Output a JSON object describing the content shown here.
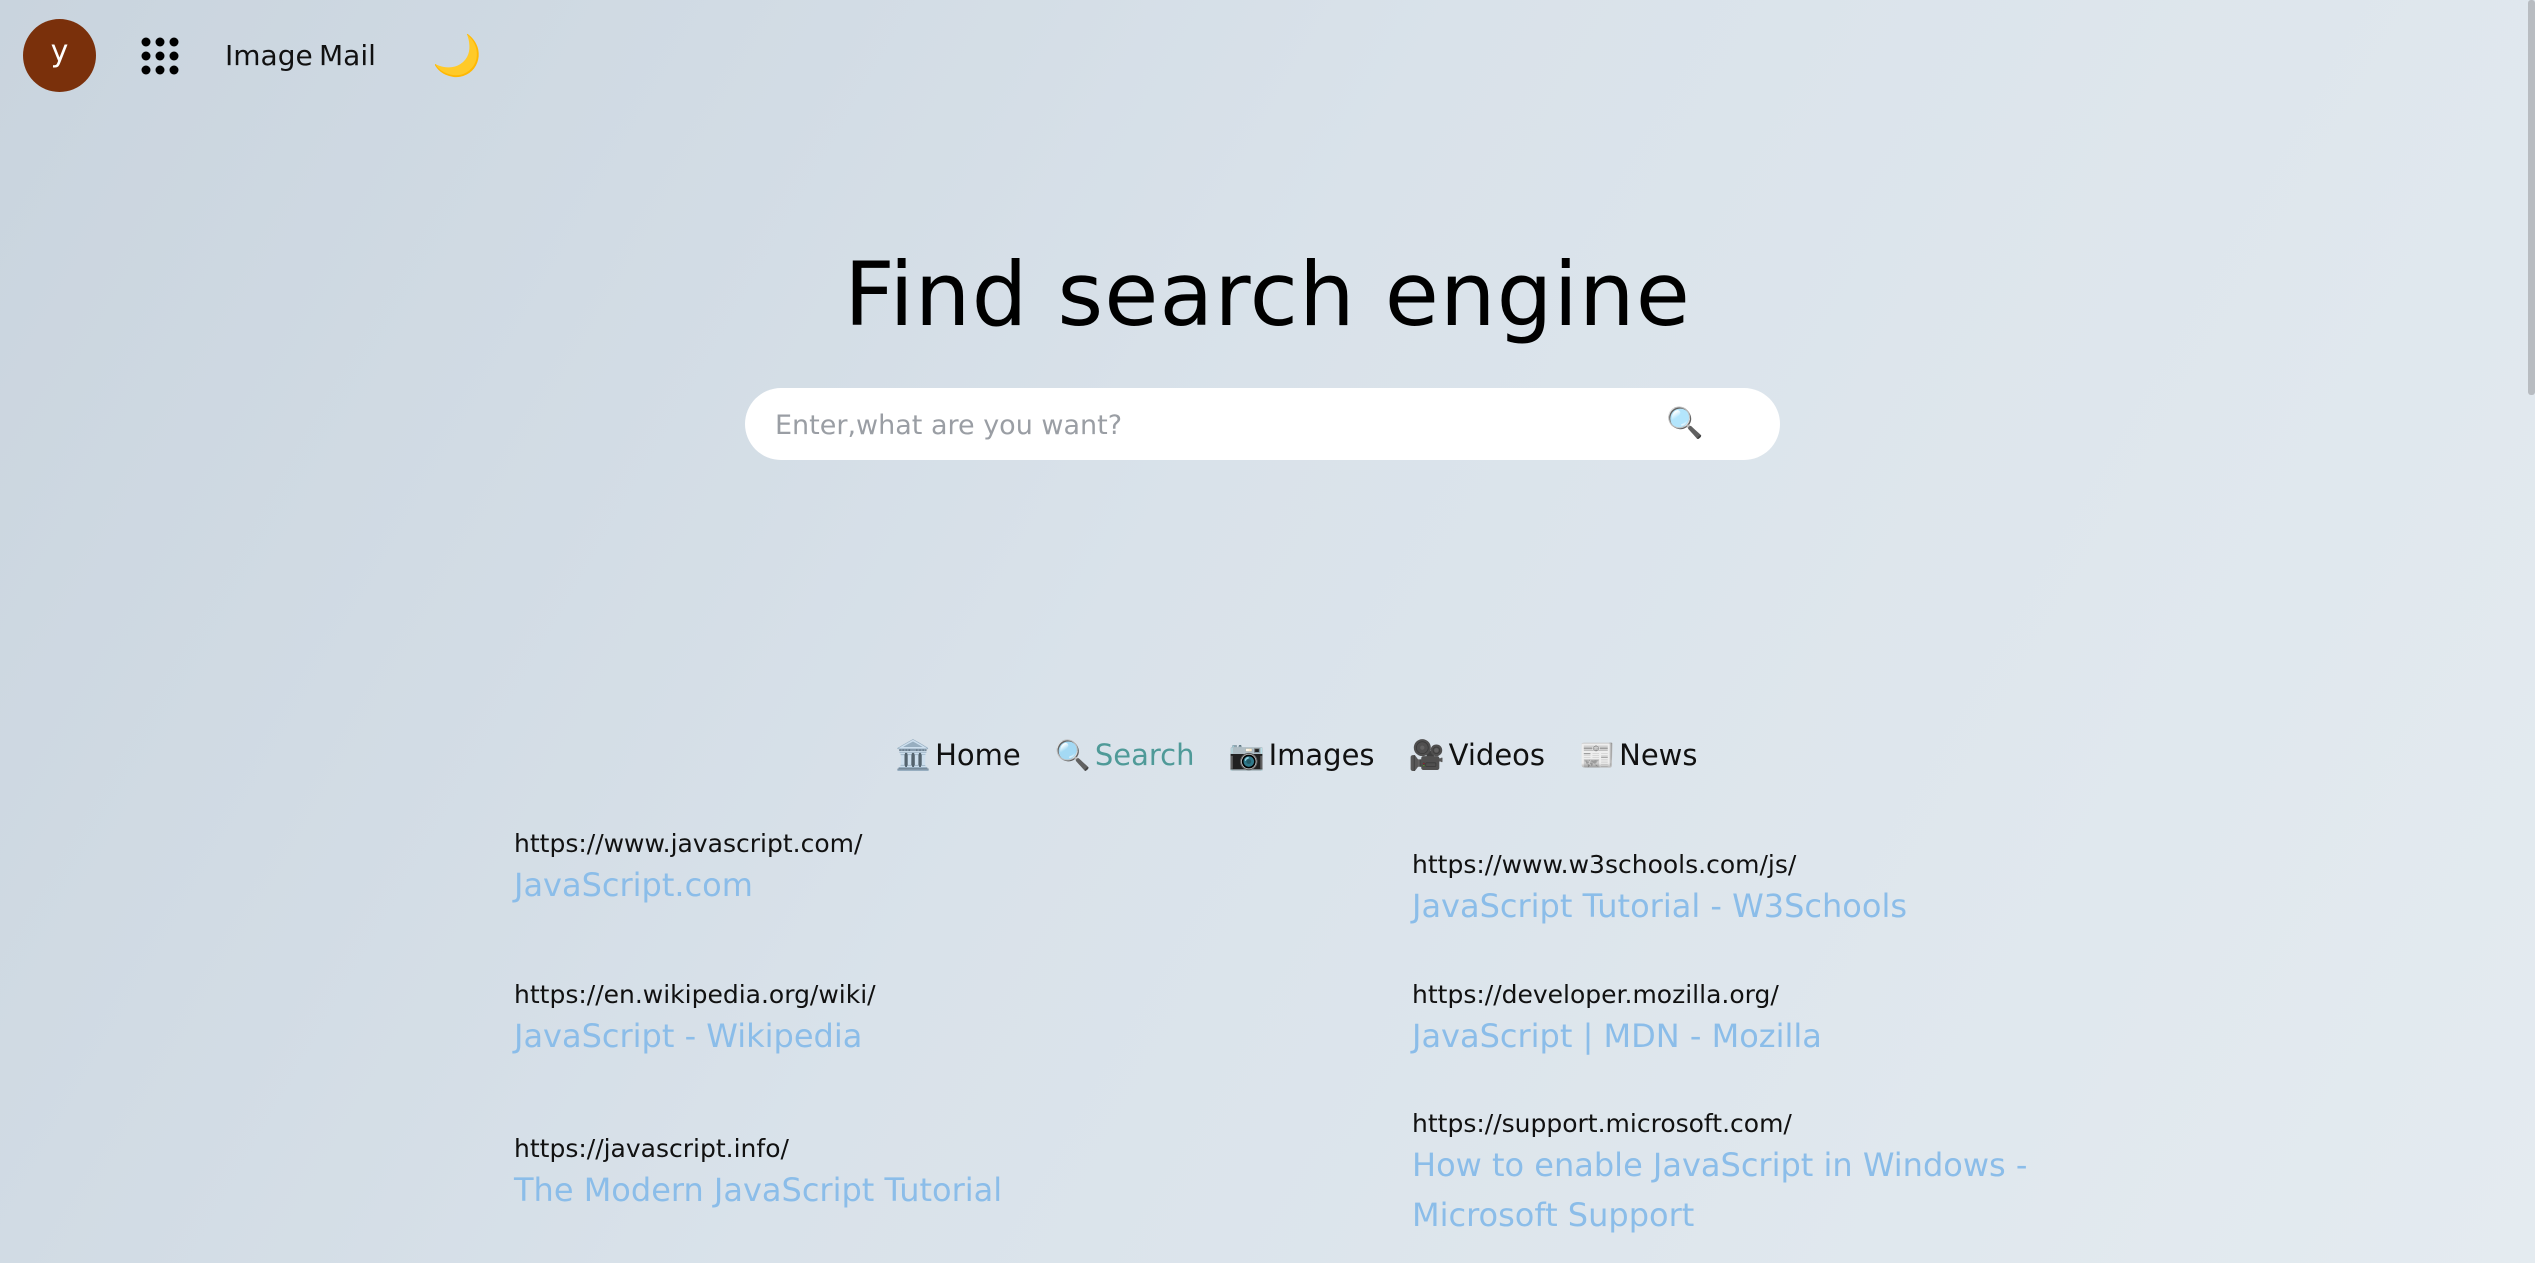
{
  "header": {
    "avatar_letter": "y",
    "apps_icon": "grid-dots-icon",
    "image_link": "Image",
    "mail_link": "Mail",
    "theme_icon": "🌙"
  },
  "hero": {
    "title": "Find search engine"
  },
  "search": {
    "placeholder": "Enter,what are you want?",
    "value": "",
    "button_icon": "🔍"
  },
  "nav": {
    "items": [
      {
        "icon": "🏛️",
        "label": "Home"
      },
      {
        "icon": "🔍",
        "label": "Search"
      },
      {
        "icon": "📷",
        "label": "Images"
      },
      {
        "icon": "🎥",
        "label": "Videos"
      },
      {
        "icon": "📰",
        "label": "News"
      }
    ],
    "active_index": 1
  },
  "results": [
    {
      "url": "https://www.javascript.com/",
      "title": "JavaScript.com"
    },
    {
      "url": "https://en.wikipedia.org/wiki/",
      "title": "JavaScript - Wikipedia"
    },
    {
      "url": "https://javascript.info/",
      "title": "The Modern JavaScript Tutorial"
    },
    {
      "url": "https://www.w3schools.com/js/",
      "title": "JavaScript Tutorial - W3Schools"
    },
    {
      "url": "https://developer.mozilla.org/",
      "title": "JavaScript | MDN - Mozilla"
    },
    {
      "url": "https://support.microsoft.com/",
      "title": "How to enable JavaScript in Windows - Microsoft Support"
    }
  ],
  "colors": {
    "avatar_bg": "#7a300b",
    "active_nav": "#4f9a98",
    "result_title": "#8bbde9"
  }
}
